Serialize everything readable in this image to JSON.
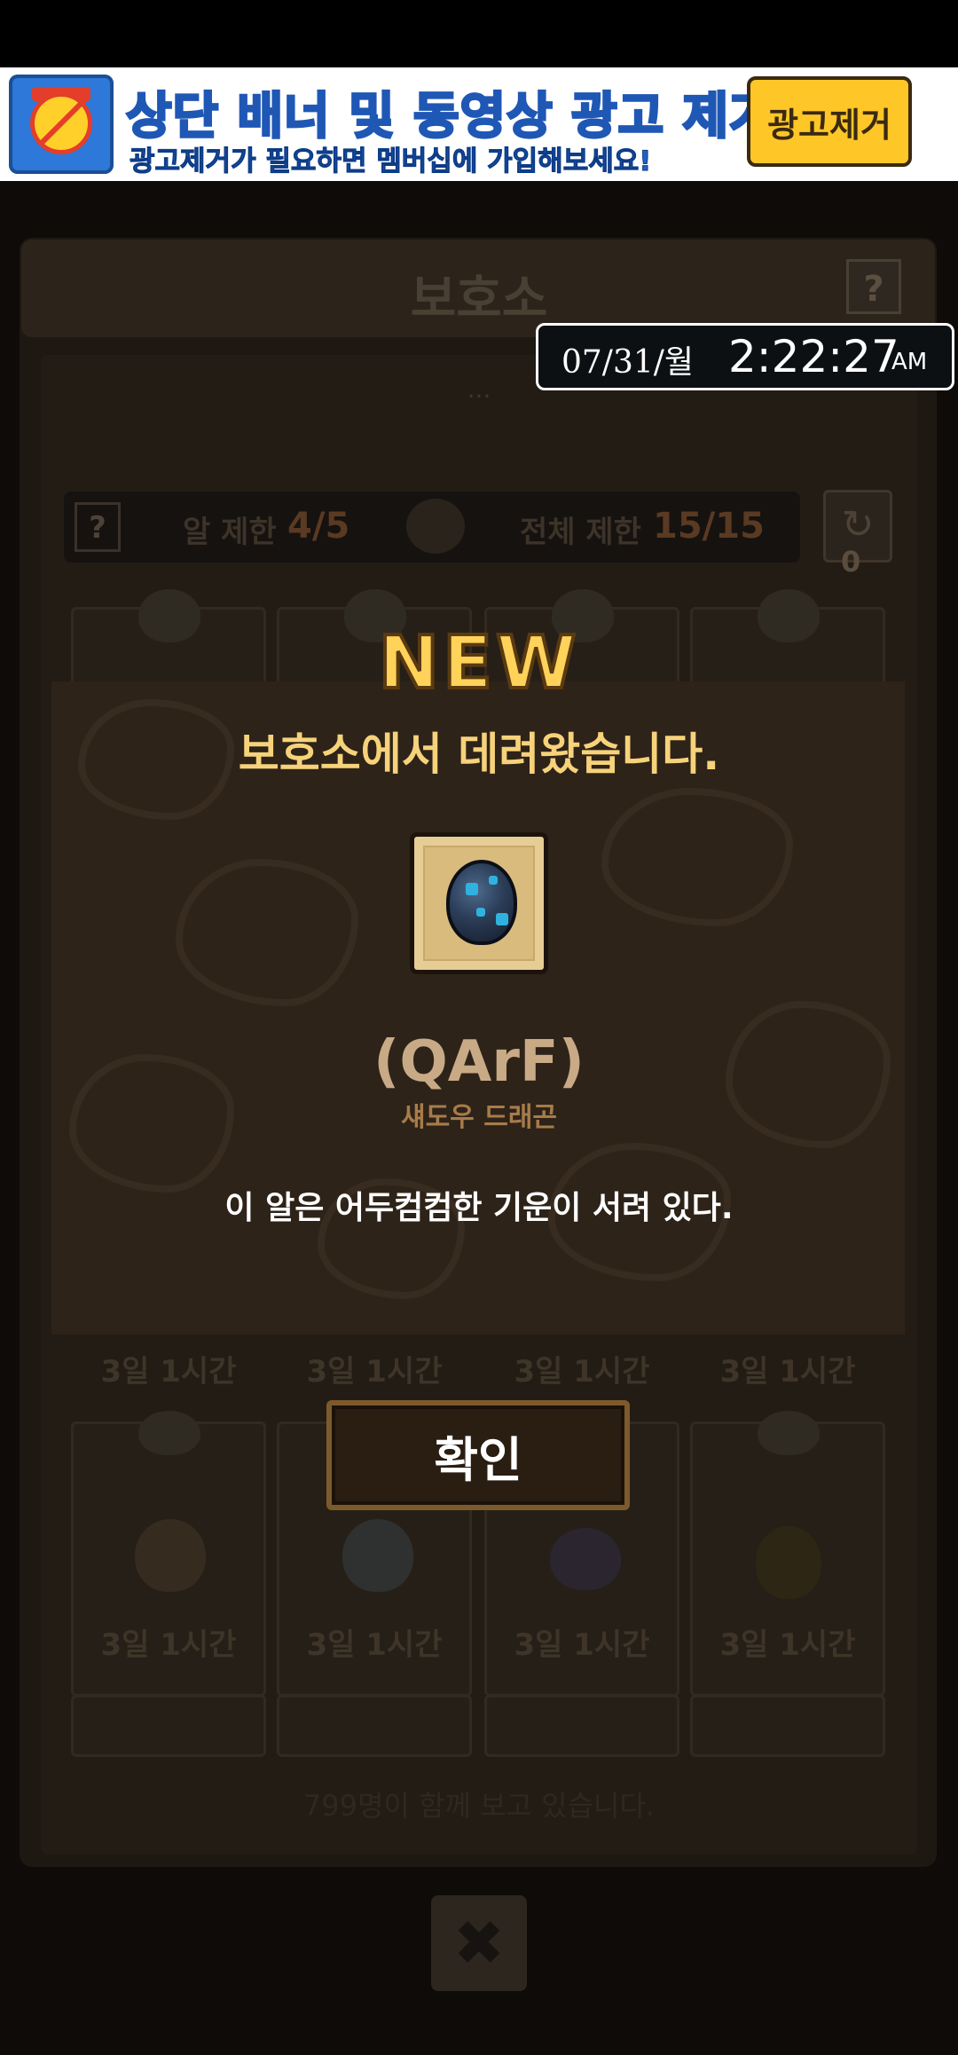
{
  "ad_banner": {
    "title": "상단 배너 및 동영상 광고 제거!",
    "subtitle": "광고제거가 필요하면 멤버십에 가입해보세요!",
    "button_label": "광고제거"
  },
  "background": {
    "title": "보호소",
    "help_label": "?",
    "description": "...",
    "limit_help": "?",
    "egg_limit_label": "알 제한",
    "egg_limit_value": "4/5",
    "total_limit_label": "전체 제한",
    "total_limit_value": "15/15",
    "refresh_count": "0",
    "slot_times": [
      "3일 1시간",
      "3일 1시간",
      "3일 1시간",
      "3일 1시간",
      "3일 1시간",
      "3일 1시간",
      "3일 1시간",
      "3일 1시간"
    ],
    "footer_text": "799명이 함께 보고 있습니다.",
    "close_label": "✖"
  },
  "clock": {
    "date": "07/31/월",
    "time": "2:22:27",
    "ampm": "AM"
  },
  "modal": {
    "badge": "NEW",
    "title": "보호소에서 데려왔습니다.",
    "egg_code": "(QArF)",
    "egg_name": "섀도우 드래곤",
    "description": "이 알은 어두컴컴한 기운이 서려 있다.",
    "confirm_label": "확인"
  }
}
